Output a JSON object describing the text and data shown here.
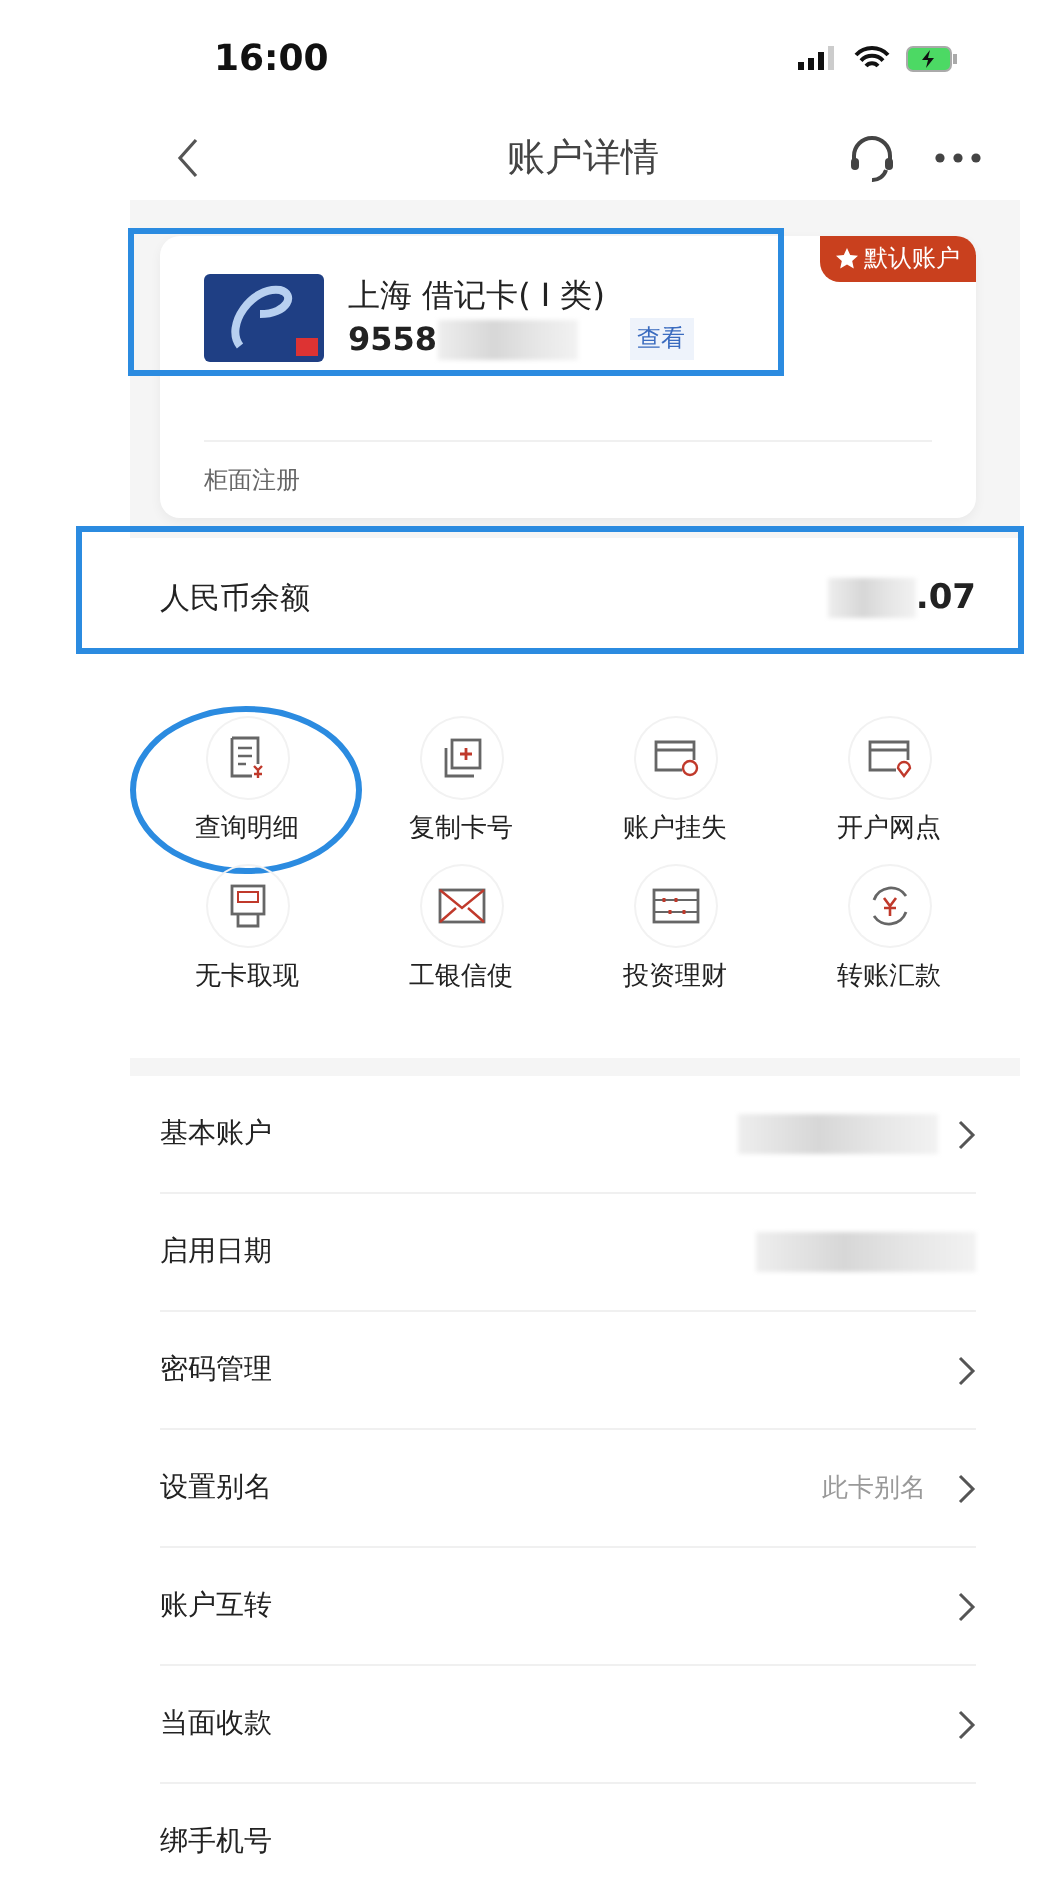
{
  "status_bar": {
    "time": "16:00"
  },
  "nav": {
    "title": "账户详情"
  },
  "card": {
    "name": "上海 借记卡( I 类)",
    "number": "9558",
    "number_redacted": true,
    "view_link": "查看",
    "badge": "默认账户",
    "footer": "柜面注册",
    "highlighted": true
  },
  "balance": {
    "label": "人民币余额",
    "value": ".07",
    "value_redacted": true,
    "highlighted": true
  },
  "actions": [
    {
      "label": "查询明细",
      "highlighted": true
    },
    {
      "label": "复制卡号",
      "highlighted": false
    },
    {
      "label": "账户挂失",
      "highlighted": false
    },
    {
      "label": "开户网点",
      "highlighted": false
    },
    {
      "label": "无卡取现",
      "highlighted": false
    },
    {
      "label": "工银信使",
      "highlighted": false
    },
    {
      "label": "投资理财",
      "highlighted": false
    },
    {
      "label": "转账汇款",
      "highlighted": false
    }
  ],
  "rows": [
    {
      "label": "基本账户",
      "redacted": true,
      "chevron": true
    },
    {
      "label": "启用日期",
      "redacted": true,
      "chevron": false
    },
    {
      "label": "密码管理",
      "redacted": false,
      "chevron": true
    },
    {
      "label": "设置别名",
      "value": "此卡别名",
      "redacted": false,
      "chevron": true
    },
    {
      "label": "账户互转",
      "redacted": false,
      "chevron": true
    },
    {
      "label": "当面收款",
      "redacted": false,
      "chevron": true
    },
    {
      "label": "绑手机号",
      "redacted": false,
      "chevron": false
    }
  ]
}
